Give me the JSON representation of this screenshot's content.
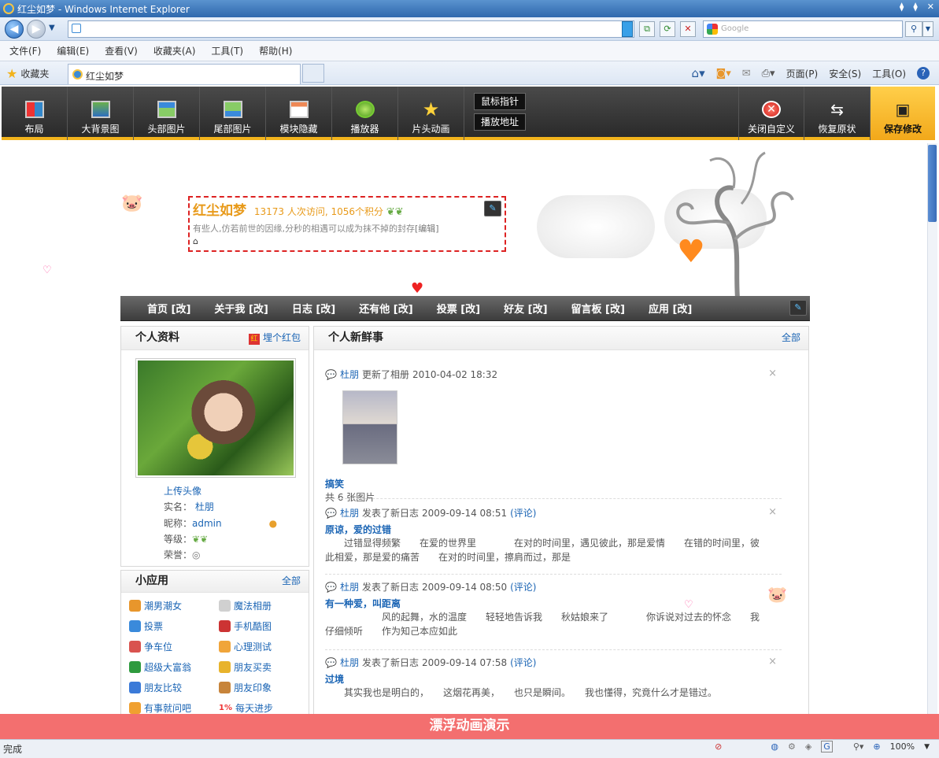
{
  "window": {
    "title": "红尘如梦 - Windows Internet Explorer",
    "search_placeholder": "Google",
    "tab_title": "红尘如梦",
    "favorites_label": "收藏夹"
  },
  "menubar": [
    "文件(F)",
    "编辑(E)",
    "查看(V)",
    "收藏夹(A)",
    "工具(T)",
    "帮助(H)"
  ],
  "commandbar": {
    "page": "页面(P)",
    "safety": "安全(S)",
    "tools": "工具(O)"
  },
  "custom_toolbar": {
    "layout": "布局",
    "bg_image": "大背景图",
    "header_image": "头部图片",
    "footer_image": "尾部图片",
    "module_hide": "模块隐藏",
    "player": "播放器",
    "intro_anim": "片头动画",
    "cursor": "鼠标指针",
    "play_url": "播放地址",
    "close_custom": "关闭自定义",
    "restore": "恢复原状",
    "save": "保存修改"
  },
  "profile": {
    "name": "红尘如梦",
    "stats": "13173 人次访问, 1056个积分",
    "signature": "有些人,仿若前世的因缘,分秒的相遇可以成为抹不掉的封存",
    "edit_link": "[编辑]"
  },
  "nav": [
    "首页 [改]",
    "关于我 [改]",
    "日志 [改]",
    "还有他 [改]",
    "投票 [改]",
    "好友 [改]",
    "留言板 [改]",
    "应用 [改]"
  ],
  "personal": {
    "title": "个人资料",
    "redpacket": "埋个红包",
    "upload_avatar": "上传头像",
    "realname_label": "实名：",
    "realname": "杜朋",
    "nick_label": "昵称：",
    "nick": "admin",
    "level_label": "等级：",
    "honor_label": "荣誉："
  },
  "apps": {
    "title": "小应用",
    "all": "全部",
    "items": [
      {
        "label": "潮男潮女",
        "icon": "people-icon",
        "color": "#e8962c"
      },
      {
        "label": "魔法相册",
        "icon": "album-icon",
        "color": "#d0d0d0"
      },
      {
        "label": "投票",
        "icon": "vote-icon",
        "color": "#3a8adb"
      },
      {
        "label": "手机酷图",
        "icon": "phone-image-icon",
        "color": "#c33"
      },
      {
        "label": "争车位",
        "icon": "parking-icon",
        "color": "#d9534f"
      },
      {
        "label": "心理测试",
        "icon": "flask-icon",
        "color": "#f0a53a"
      },
      {
        "label": "超级大富翁",
        "icon": "monopoly-icon",
        "color": "#2e9a3e"
      },
      {
        "label": "朋友买卖",
        "icon": "coins-icon",
        "color": "#e8b32c"
      },
      {
        "label": "朋友比较",
        "icon": "compare-icon",
        "color": "#3a7ad8"
      },
      {
        "label": "朋友印象",
        "icon": "impression-icon",
        "color": "#c7843a"
      },
      {
        "label": "有事就问吧",
        "icon": "ask-icon",
        "color": "#f0a030"
      },
      {
        "label": "每天进步",
        "icon": "progress-icon",
        "color": "#e33"
      }
    ],
    "progress_prefix": "1%"
  },
  "feed": {
    "title": "个人新鲜事",
    "all": "全部",
    "items": [
      {
        "user": "杜朋",
        "action": "更新了相册",
        "time": "2010-04-02 18:32",
        "comment": "",
        "title": "搞笑",
        "body": "共 6 张图片"
      },
      {
        "user": "杜朋",
        "action": "发表了新日志",
        "time": "2009-09-14 08:51",
        "comment": "(评论)",
        "title": "原谅，爱的过错",
        "body": "　　过错显得频繁　　在爱的世界里　　　　在对的时间里，遇见彼此，那是爱情　　在错的时间里，彼此相爱，那是爱的痛苦　　在对的时间里，擦肩而过，那是"
      },
      {
        "user": "杜朋",
        "action": "发表了新日志",
        "time": "2009-09-14 08:50",
        "comment": "(评论)",
        "title": "有一种爱，叫距离",
        "body": "　　　　　　风的起舞，水的温度　　轻轻地告诉我　　秋姑娘来了　　　　你诉说对过去的怀念　　我仔细倾听　　作为知己本应如此"
      },
      {
        "user": "杜朋",
        "action": "发表了新日志",
        "time": "2009-09-14 07:58",
        "comment": "(评论)",
        "title": "过境",
        "body": "　　其实我也是明白的，　　这烟花再美，　　也只是瞬间。　　我也懂得，究竟什么才是错过。"
      }
    ]
  },
  "banner": "漂浮动画演示",
  "status": {
    "left": "完成",
    "zoom": "100%"
  }
}
